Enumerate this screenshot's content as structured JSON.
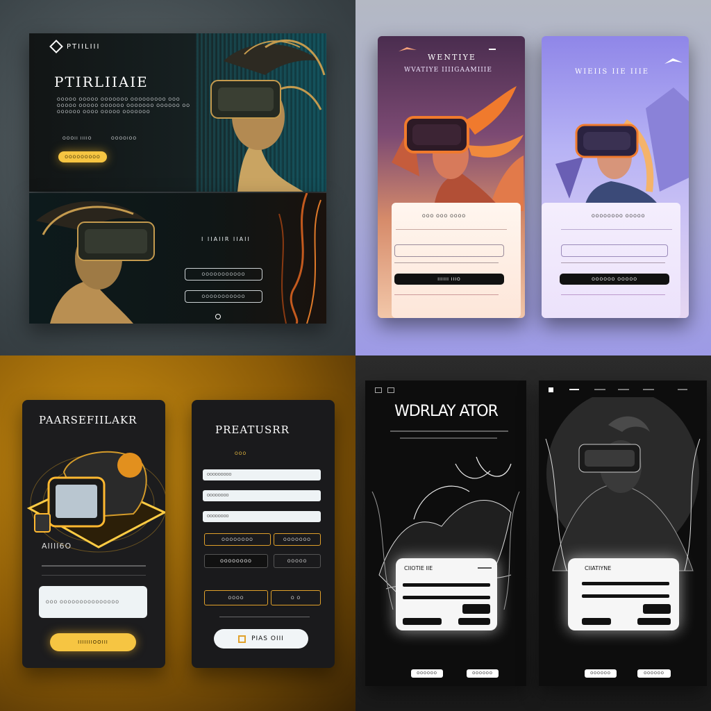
{
  "panel1": {
    "brand": "PTIILIII",
    "title": "PTIRLIIAIE",
    "desc_lines": [
      "OOOOO OOOOO OOOOOOO OOOOOOOOO OOO",
      "OOOOO OOOOO OOOOOO OOOOOOO OOOOOO OO",
      "OOOOOO OOOO OOOOO OOOOOOO"
    ],
    "link_a": "OOOII IIIIO",
    "link_b": "OOOOIOO",
    "cta": "OOOOOOOOO",
    "section_title": "I IIAIIR IIAII",
    "btn1": "OOOOOOOOOOO",
    "btn2": "OOOOOOOOOOO"
  },
  "panel2": {
    "left": {
      "title1": "WENTIYE",
      "title2": "WVATIYE IIIIGAAMIIIE",
      "form_title": "OOO OOO OOOO",
      "submit": "IIIIII IIIO"
    },
    "right": {
      "title": "WIEIIS IIE IIIE",
      "form_title": "OOOOOOOO OOOOO",
      "submit": "OOOOOO OOOOO"
    }
  },
  "panel3": {
    "left": {
      "title": "PAARSEFIILAKR",
      "subtitle": "AIIII6O",
      "input_placeholder": "OOO OOOOOOOOOOOOOOO",
      "cta": "IIIIIIIOOIII"
    },
    "right": {
      "title": "PREATUSRR",
      "meta": "OOO",
      "field_labels": [
        "OOOOOOOOO",
        "OOOOOOOO",
        "OOOOOOOO"
      ],
      "pill_labels": [
        "OOOOOOOO",
        "OOOOOOO",
        "OOOOOOOO",
        "OOOOO",
        "OOOO",
        "O O"
      ],
      "cta": "PIAS OIII"
    }
  },
  "panel4": {
    "left": {
      "title": "WDRLAY ATOR",
      "form_title": "CIIOTIE IIE",
      "btn_a": "OOOOOO",
      "btn_b": "OOOOOO"
    },
    "right": {
      "form_title": "CIIATIYNE",
      "btn_a": "OOOOOO",
      "btn_b": "OOOOOO"
    }
  },
  "colors": {
    "gold": "#f6c542",
    "dark": "#141414",
    "teal": "#1fa2b6",
    "orange": "#f07a2d",
    "lavender": "#a7a4ea"
  }
}
